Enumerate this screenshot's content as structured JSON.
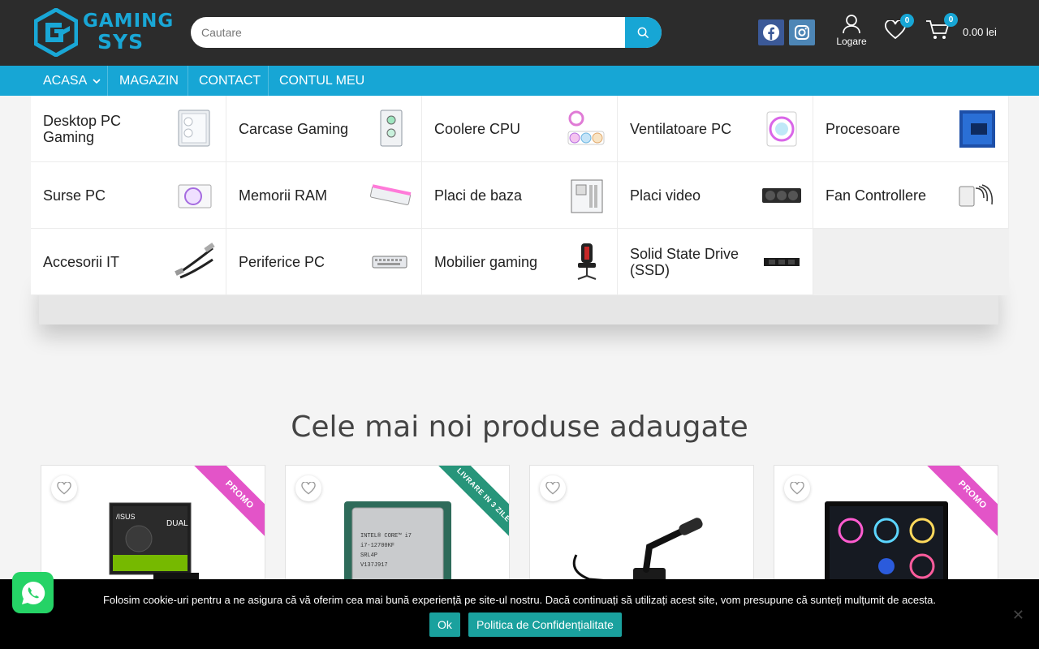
{
  "brand": {
    "line1": "GAMING",
    "line2": "SYS",
    "color": "#19a7d6"
  },
  "search": {
    "placeholder": "Cautare"
  },
  "header": {
    "login_label": "Logare",
    "wishlist_count": "0",
    "cart_count": "0",
    "cart_total": "0.00 lei"
  },
  "nav": {
    "items": [
      "ACASA",
      "MAGAZIN",
      "CONTACT",
      "CONTUL MEU"
    ]
  },
  "mega_menu": {
    "categories": [
      "Desktop PC Gaming",
      "Carcase Gaming",
      "Coolere CPU",
      "Ventilatoare PC",
      "Procesoare",
      "Surse PC",
      "Memorii RAM",
      "Placi de baza",
      "Placi video",
      "Fan Controllere",
      "Accesorii IT",
      "Periferice PC",
      "Mobilier gaming",
      "Solid State Drive (SSD)"
    ]
  },
  "section": {
    "title": "Cele mai noi produse adaugate"
  },
  "products": [
    {
      "ribbon": "PROMO"
    },
    {
      "ribbon": "LIVRARE IN 3 ZILE"
    },
    {
      "ribbon": ""
    },
    {
      "ribbon": "PROMO"
    }
  ],
  "cookie": {
    "text": "Folosim cookie-uri pentru a ne asigura că vă oferim cea mai bună experiență pe site-ul nostru. Dacă continuați să utilizați acest site, vom presupune că sunteți mulțumit de acesta.",
    "ok_label": "Ok",
    "policy_label": "Politica de Confidențialitate",
    "close_label": "✕"
  },
  "colors": {
    "accent": "#17a6d5",
    "header_bg": "#2c2c2c",
    "promo": "#e354c8",
    "livrare": "#27957a",
    "cookie_btn": "#1aa19e"
  }
}
